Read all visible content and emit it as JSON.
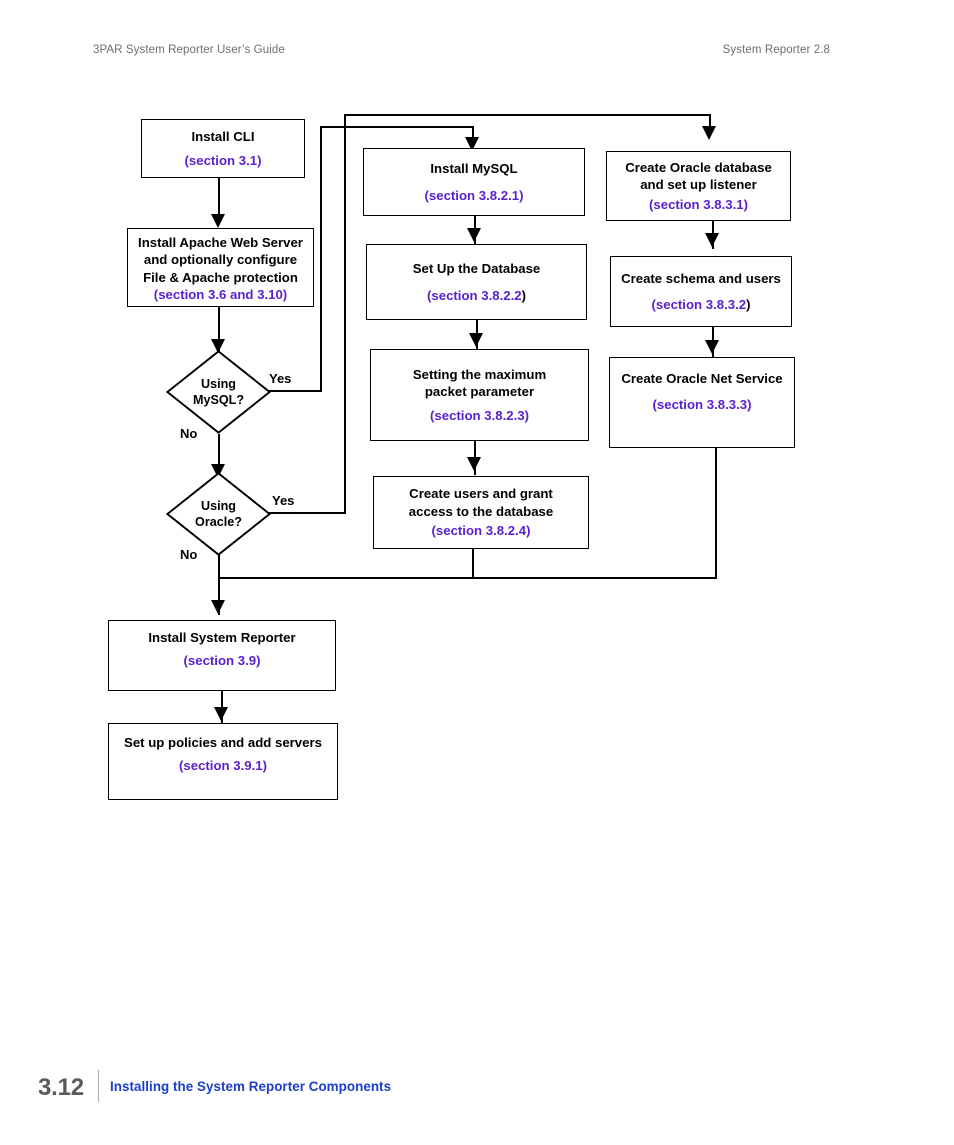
{
  "header": {
    "left": "3PAR System Reporter User’s Guide",
    "right": "System Reporter 2.8"
  },
  "footer": {
    "page_number": "3.12",
    "section_title": "Installing the System Reporter Components"
  },
  "colors": {
    "section_ref": "#5a1fd0",
    "footer_title": "#1b3fcb",
    "running_head": "#6d6e70",
    "line": "#000000"
  },
  "flowchart": {
    "nodes": {
      "install_cli": {
        "title": "Install CLI",
        "ref": "(section 3.1)"
      },
      "install_apache": {
        "title": "Install Apache Web Server\nand optionally configure\nFile & Apache protection",
        "ref": "(section 3.6 and 3.10)"
      },
      "install_mysql": {
        "title": "Install MySQL",
        "ref": "(section 3.8.2.1)"
      },
      "setup_database": {
        "title": "Set Up the Database",
        "ref": "(section 3.8.2.2",
        "ref_tail": ")"
      },
      "max_packet": {
        "title": "Setting the maximum\npacket parameter",
        "ref": "(section 3.8.2.3)"
      },
      "create_users_grant": {
        "title": "Create users and grant\naccess to the database",
        "ref": "(section 3.8.2.4)"
      },
      "create_oracle_db": {
        "title": "Create Oracle database\nand set up listener",
        "ref": "(section 3.8.3.1)"
      },
      "create_schema": {
        "title": "Create schema and users",
        "ref": "(section 3.8.3.2",
        "ref_tail": ")"
      },
      "oracle_net_service": {
        "title": "Create Oracle Net Service",
        "ref": "(section 3.8.3.3)"
      },
      "install_sysrep": {
        "title": "Install System Reporter",
        "ref": "(section 3.9)"
      },
      "setup_policies": {
        "title": "Set up policies and add servers",
        "ref": "(section 3.9.1)"
      }
    },
    "decisions": {
      "using_mysql": {
        "label": "Using\nMySQL?"
      },
      "using_oracle": {
        "label": "Using\nOracle?"
      }
    },
    "branch_labels": {
      "mysql_yes": "Yes",
      "mysql_no": "No",
      "oracle_yes": "Yes",
      "oracle_no": "No"
    }
  }
}
